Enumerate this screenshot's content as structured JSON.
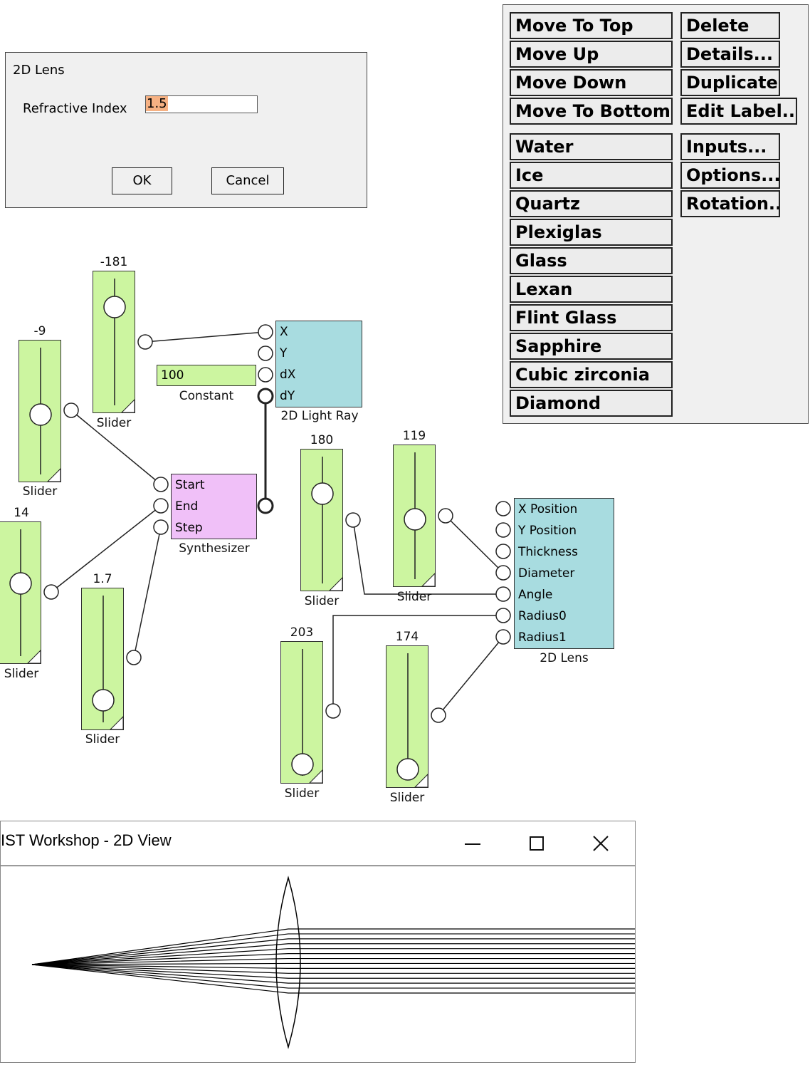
{
  "dialog": {
    "title": "2D Lens",
    "field_label": "Refractive Index",
    "field_value": "1.5",
    "ok": "OK",
    "cancel": "Cancel"
  },
  "menu": {
    "left_top": [
      "Move To Top",
      "Move Up",
      "Move Down",
      "Move To Bottom"
    ],
    "right_top": [
      "Delete",
      "Details...",
      "Duplicate",
      "Edit Label..."
    ],
    "materials": [
      "Water",
      "Ice",
      "Quartz",
      "Plexiglas",
      "Glass",
      "Lexan",
      "Flint Glass",
      "Sapphire",
      "Cubic zirconia",
      "Diamond"
    ],
    "right_bottom": [
      "Inputs...",
      "Options...",
      "Rotation..."
    ]
  },
  "sliders": {
    "s1": {
      "value": "-181",
      "label": "Slider"
    },
    "s2": {
      "value": "-9",
      "label": "Slider"
    },
    "s3": {
      "value": "14",
      "label": "Slider"
    },
    "s4": {
      "value": "1.7",
      "label": "Slider"
    },
    "s5": {
      "value": "180",
      "label": "Slider"
    },
    "s6": {
      "value": "119",
      "label": "Slider"
    },
    "s7": {
      "value": "203",
      "label": "Slider"
    },
    "s8": {
      "value": "174",
      "label": "Slider"
    }
  },
  "constant": {
    "value": "100",
    "label": "Constant"
  },
  "light_ray": {
    "label": "2D Light Ray",
    "ports": [
      "X",
      "Y",
      "dX",
      "dY"
    ]
  },
  "synth": {
    "label": "Synthesizer",
    "ports": [
      "Start",
      "End",
      "Step"
    ]
  },
  "lens": {
    "label": "2D Lens",
    "ports": [
      "X Position",
      "Y Position",
      "Thickness",
      "Diameter",
      "Angle",
      "Radius0",
      "Radius1"
    ]
  },
  "window": {
    "title": "IST Workshop - 2D View"
  },
  "colors": {
    "slider": "#ccf5a0",
    "ray_block": "#a8dce0",
    "synth_block": "#f0c0f8",
    "selection": "#f6b183"
  }
}
